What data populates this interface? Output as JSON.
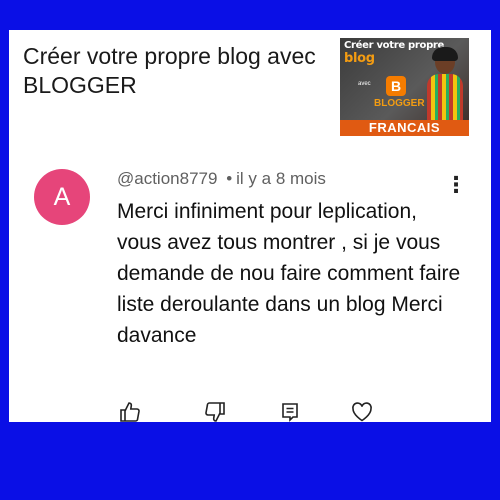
{
  "video": {
    "title": "Créer votre propre blog avec BLOGGER",
    "thumbnail": {
      "line1_small": "Créer votre propre",
      "line1_big": "blog",
      "avec": "avec",
      "logo_letter": "B",
      "blogger": "BLOGGER",
      "band": "FRANCAIS"
    }
  },
  "comment": {
    "avatar_letter": "A",
    "avatar_color": "#e6457a",
    "author": "@action8779",
    "separator": "•",
    "time": "il y a 8 mois",
    "text": "Merci infiniment pour leplication, vous avez tous montrer , si je vous demande de nou faire comment faire liste deroulante dans un blog Merci davance"
  },
  "actions": [
    {
      "icon": "thumb-up-icon"
    },
    {
      "icon": "thumb-down-icon"
    },
    {
      "icon": "reply-icon"
    },
    {
      "icon": "heart-icon"
    }
  ],
  "colors": {
    "border": "#0a0fe6",
    "card": "#ffffff"
  }
}
